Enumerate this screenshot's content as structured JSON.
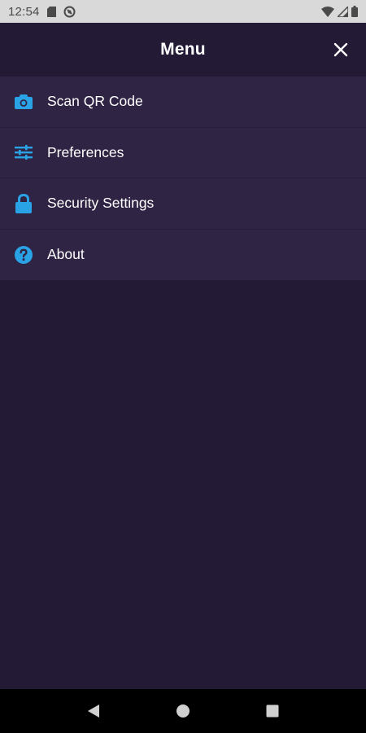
{
  "status_bar": {
    "time": "12:54",
    "icons": [
      "sd-card-icon",
      "sync-icon",
      "wifi-icon",
      "signal-icon",
      "battery-icon"
    ]
  },
  "header": {
    "title": "Menu",
    "close_icon": "close-icon"
  },
  "menu": {
    "items": [
      {
        "label": "Scan QR Code",
        "icon": "camera-icon"
      },
      {
        "label": "Preferences",
        "icon": "sliders-icon"
      },
      {
        "label": "Security Settings",
        "icon": "lock-icon"
      },
      {
        "label": "About",
        "icon": "help-icon"
      }
    ]
  },
  "nav_bar": {
    "buttons": [
      "back-icon",
      "home-icon",
      "recents-icon"
    ]
  },
  "colors": {
    "background": "#231a36",
    "menu_item_bg": "#2f2443",
    "accent_icon": "#2aa3e6",
    "text": "#ffffff",
    "status_bar": "#d9d9d9",
    "nav_bar": "#000000"
  }
}
